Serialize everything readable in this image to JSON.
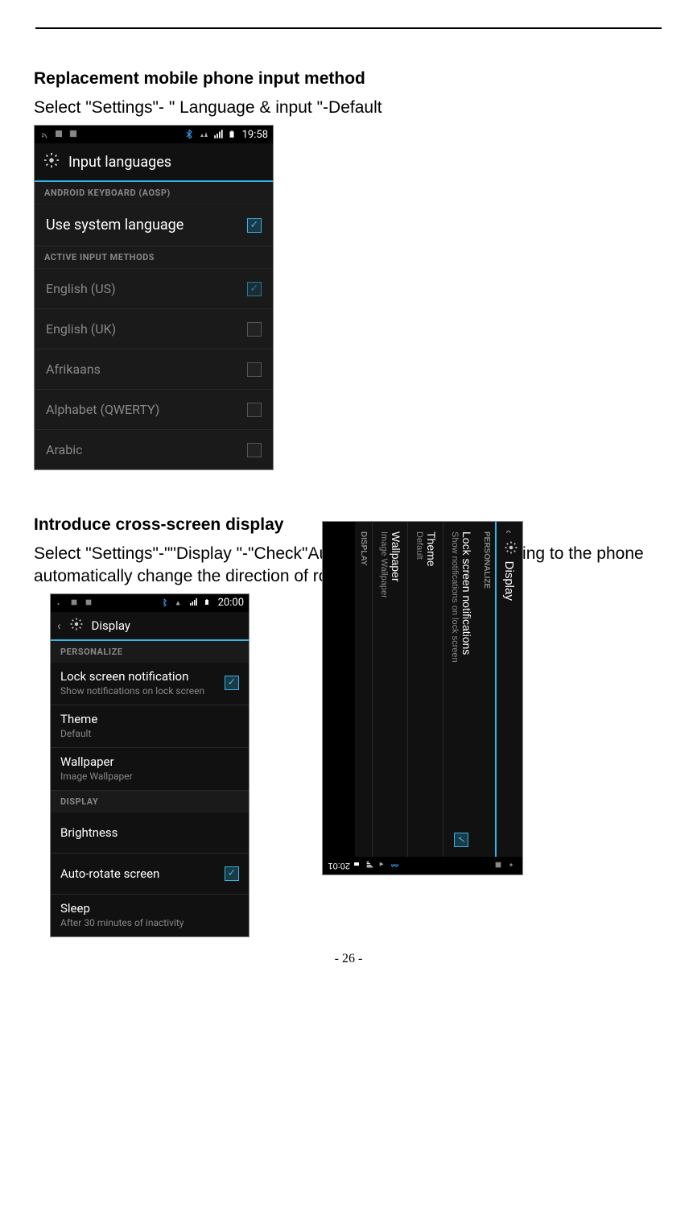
{
  "doc": {
    "heading1": "Replacement mobile phone input method",
    "desc1": "Select \"Settings\"- \" Language & input \"-Default",
    "heading2": "Introduce cross-screen display",
    "desc2": "Select \"Settings\"-\"\"Display \"-\"Check\"Auto- rotate screen, \" according to the phone automatically change the direction of rotation",
    "page_number": "- 26 -"
  },
  "phone1": {
    "status_time": "19:58",
    "appbar_title": "Input languages",
    "sections": {
      "keyboard_header": "ANDROID KEYBOARD (AOSP)",
      "active_header": "ACTIVE INPUT METHODS"
    },
    "use_system": {
      "label": "Use system language",
      "checked": true
    },
    "methods": [
      {
        "label": "English (US)",
        "checked": true,
        "disabled": true
      },
      {
        "label": "English (UK)",
        "checked": false
      },
      {
        "label": "Afrikaans",
        "checked": false
      },
      {
        "label": "Alphabet (QWERTY)",
        "checked": false
      },
      {
        "label": "Arabic",
        "checked": false
      }
    ]
  },
  "phone2": {
    "status_time": "20:00",
    "appbar_title": "Display",
    "sections": {
      "personalize": "PERSONALIZE",
      "display": "DISPLAY"
    },
    "lock": {
      "title": "Lock screen notification",
      "sub": "Show notifications on lock screen",
      "checked": true
    },
    "theme": {
      "title": "Theme",
      "sub": "Default"
    },
    "wallpaper": {
      "title": "Wallpaper",
      "sub": "Image Wallpaper"
    },
    "brightness": {
      "title": "Brightness"
    },
    "autorotate": {
      "title": "Auto-rotate screen",
      "checked": true
    },
    "sleep": {
      "title": "Sleep",
      "sub": "After 30 minutes of inactivity"
    }
  },
  "phone3": {
    "status_time": "20:01",
    "appbar_title": "Display",
    "sections": {
      "personalize": "PERSONALIZE",
      "display": "DISPLAY"
    },
    "lock": {
      "title": "Lock screen notifications",
      "sub": "Show notifications on lock screen",
      "checked": true
    },
    "theme": {
      "title": "Theme",
      "sub": "Default"
    },
    "wallpaper": {
      "title": "Wallpaper",
      "sub": "Image Wallpaper"
    }
  }
}
